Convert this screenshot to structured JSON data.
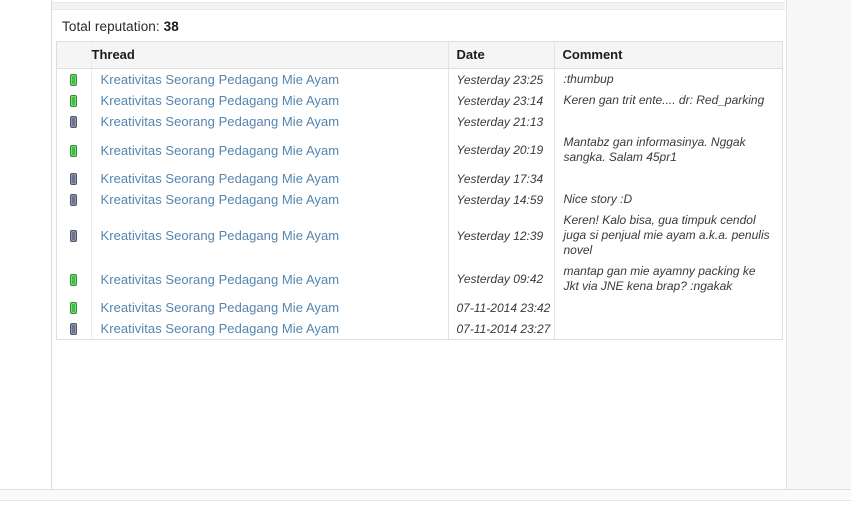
{
  "summary": {
    "label": "Total reputation:",
    "total": "38"
  },
  "table": {
    "headers": {
      "icon": "",
      "thread": "Thread",
      "date": "Date",
      "comment": "Comment"
    },
    "rows": [
      {
        "rep_state": "positive",
        "rep_icon": "reputation-bar-green-icon",
        "thread": "Kreativitas Seorang Pedagang Mie Ayam",
        "date": "Yesterday 23:25",
        "comment": ":thumbup"
      },
      {
        "rep_state": "positive",
        "rep_icon": "reputation-bar-green-icon",
        "thread": "Kreativitas Seorang Pedagang Mie Ayam",
        "date": "Yesterday 23:14",
        "comment": "Keren gan trit ente.... dr: Red_parking"
      },
      {
        "rep_state": "neutral",
        "rep_icon": "reputation-bar-grey-icon",
        "thread": "Kreativitas Seorang Pedagang Mie Ayam",
        "date": "Yesterday 21:13",
        "comment": ""
      },
      {
        "rep_state": "positive",
        "rep_icon": "reputation-bar-green-icon",
        "thread": "Kreativitas Seorang Pedagang Mie Ayam",
        "date": "Yesterday 20:19",
        "comment": "Mantabz gan informasinya. Nggak sangka. Salam 45pr1"
      },
      {
        "rep_state": "neutral",
        "rep_icon": "reputation-bar-grey-icon",
        "thread": "Kreativitas Seorang Pedagang Mie Ayam",
        "date": "Yesterday 17:34",
        "comment": ""
      },
      {
        "rep_state": "neutral",
        "rep_icon": "reputation-bar-grey-icon",
        "thread": "Kreativitas Seorang Pedagang Mie Ayam",
        "date": "Yesterday 14:59",
        "comment": "Nice story :D"
      },
      {
        "rep_state": "neutral",
        "rep_icon": "reputation-bar-grey-icon",
        "thread": "Kreativitas Seorang Pedagang Mie Ayam",
        "date": "Yesterday 12:39",
        "comment": "Keren! Kalo bisa, gua timpuk cendol juga si penjual mie ayam a.k.a. penulis novel"
      },
      {
        "rep_state": "positive",
        "rep_icon": "reputation-bar-green-icon",
        "thread": "Kreativitas Seorang Pedagang Mie Ayam",
        "date": "Yesterday 09:42",
        "comment": "mantap gan mie ayamny packing ke Jkt via JNE kena brap? :ngakak"
      },
      {
        "rep_state": "positive",
        "rep_icon": "reputation-bar-green-icon",
        "thread": "Kreativitas Seorang Pedagang Mie Ayam",
        "date": "07-11-2014 23:42",
        "comment": ""
      },
      {
        "rep_state": "neutral",
        "rep_icon": "reputation-bar-grey-icon",
        "thread": "Kreativitas Seorang Pedagang Mie Ayam",
        "date": "07-11-2014 23:27",
        "comment": ""
      }
    ]
  },
  "colors": {
    "link": "#5585ad",
    "positive": "#3fbf3f",
    "neutral": "#6e7490",
    "header_bg": "#f5f5f5",
    "border": "#dedede"
  }
}
